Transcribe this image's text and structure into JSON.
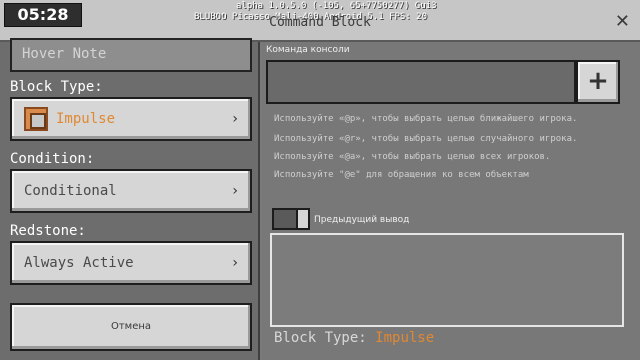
{
  "status": {
    "clock": "05:28",
    "debug_line1": "alpha 1.0.5.0 (-105, 65+7750277) Gui3",
    "debug_line2": "BLUBOO Picasso Mali-400 Android 5.1 FPS: 20"
  },
  "window": {
    "title": "Command Block",
    "close_glyph": "✕"
  },
  "left": {
    "hover_note_placeholder": "Hover Note",
    "block_type_label": "Block Type:",
    "block_type_value": "Impulse",
    "condition_label": "Condition:",
    "condition_value": "Conditional",
    "redstone_label": "Redstone:",
    "redstone_value": "Always Active",
    "chevron": "›",
    "cancel_label": "Отмена",
    "icons": {
      "block": "impulse-command-block-icon"
    }
  },
  "right": {
    "command_label": "Команда консоли",
    "command_value": "",
    "add_glyph": "+",
    "hints": [
      "Используйте «@p», чтобы выбрать целью ближайшего игрока.",
      "Используйте «@r», чтобы выбрать целью случайного игрока.",
      "Используйте «@a», чтобы выбрать целью всех игроков.",
      "Используйте \"@e\" для обращения ко всем объектам"
    ],
    "previous_output_label": "Предыдущий вывод",
    "previous_output_toggle_on": true,
    "output_value": "",
    "bottom_block_type_label": "Block Type:",
    "bottom_block_type_value": "Impulse"
  },
  "colors": {
    "accent_orange": "#e08832",
    "button_face": "#d6d6d6",
    "panel_bg": "#787878",
    "left_bg": "#6d6d6d"
  }
}
